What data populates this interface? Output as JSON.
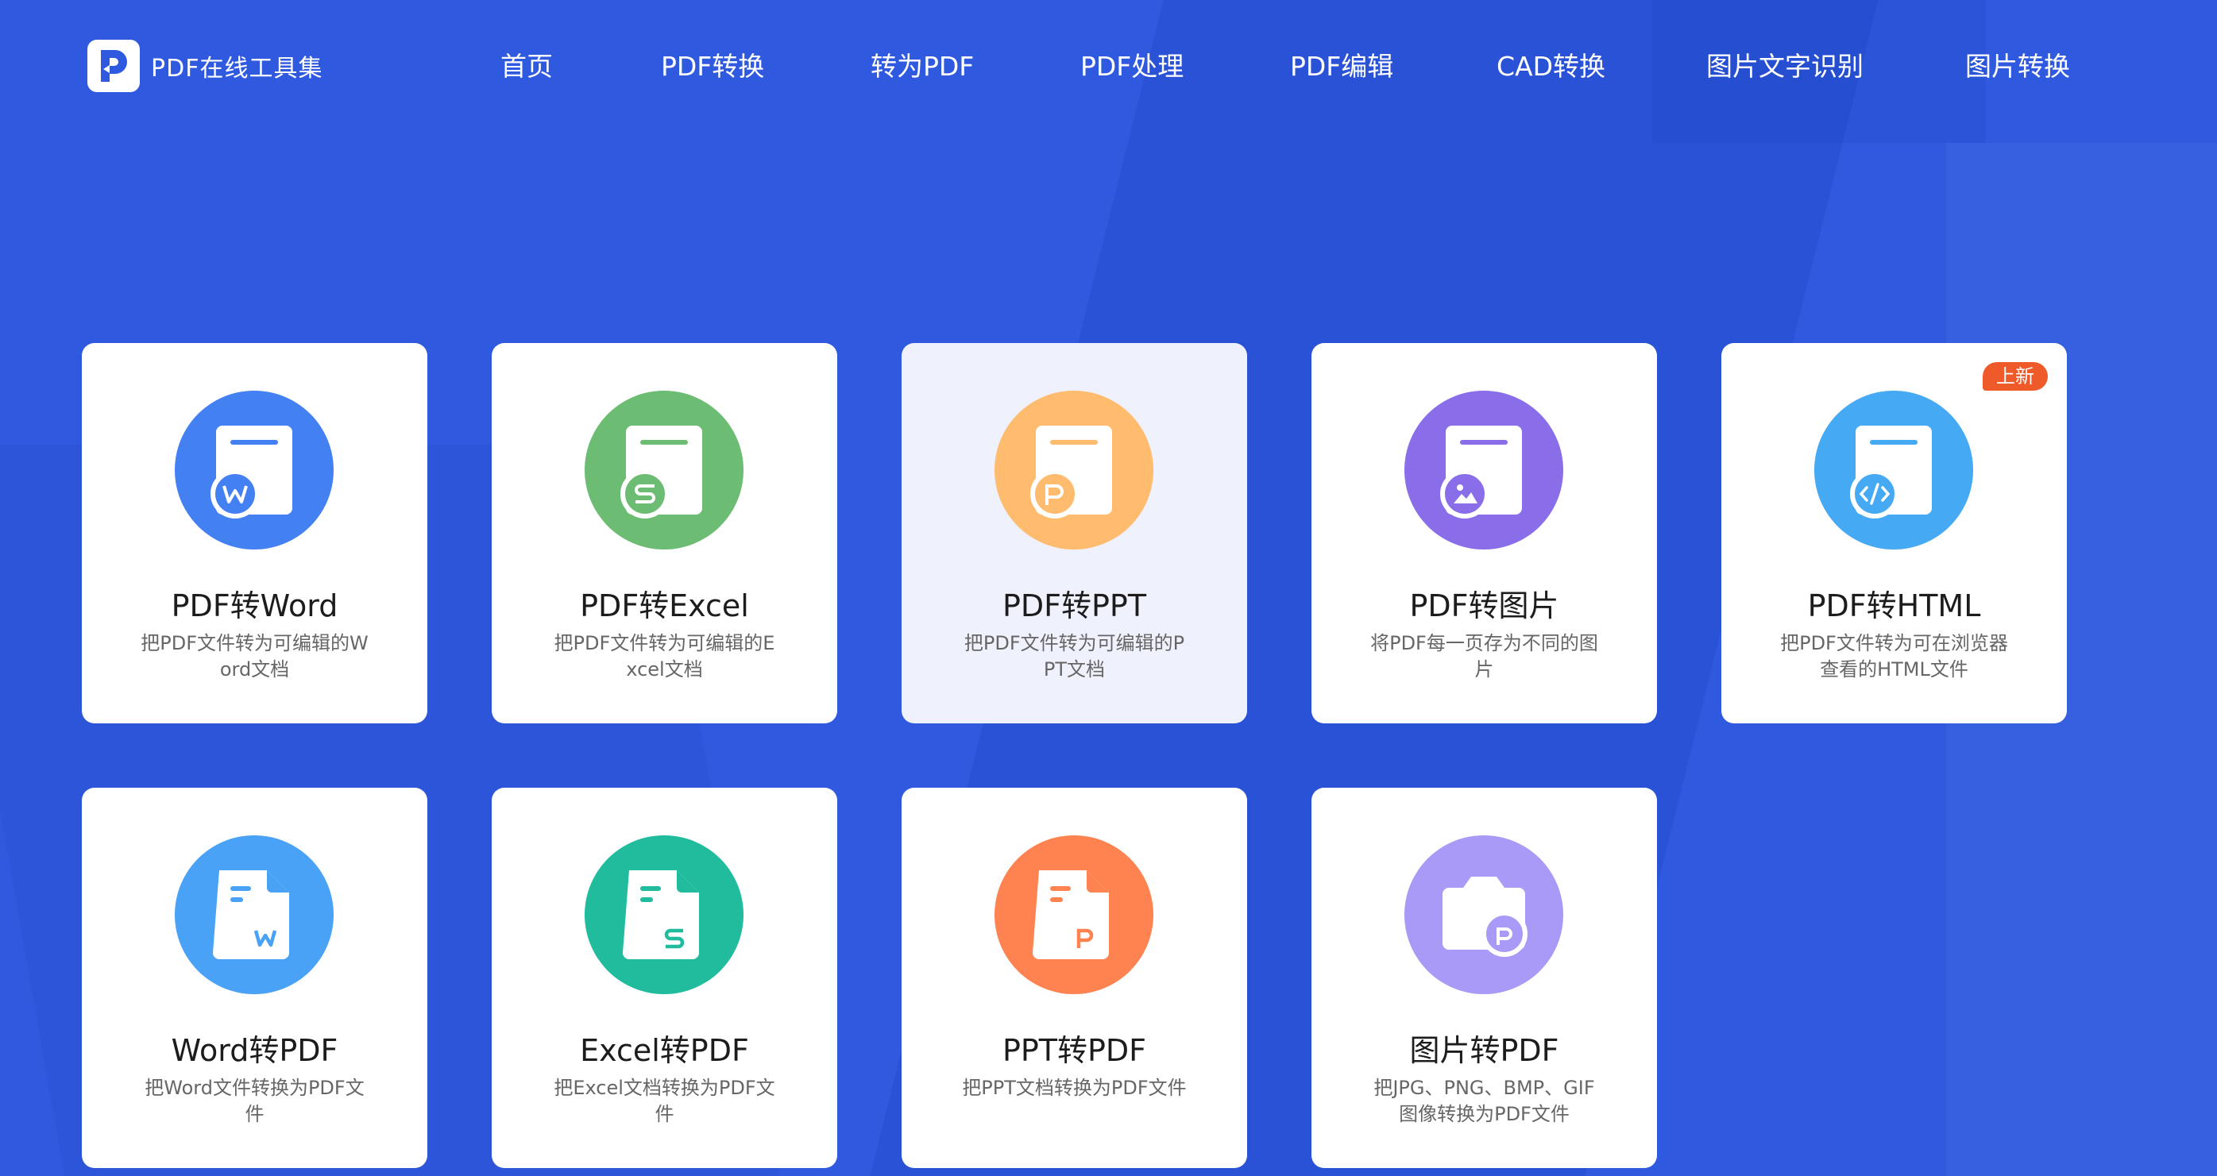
{
  "header": {
    "logo_text": "PDF在线工具集",
    "nav": [
      "首页",
      "PDF转换",
      "转为PDF",
      "PDF处理",
      "PDF编辑",
      "CAD转换",
      "图片文字识别",
      "图片转换"
    ]
  },
  "cards": [
    {
      "title": "PDF转Word",
      "desc": "把PDF文件转为可编辑的Word文档",
      "color": "#4381f3",
      "icon": "pdf-to-word-icon"
    },
    {
      "title": "PDF转Excel",
      "desc": "把PDF文件转为可编辑的Excel文档",
      "color": "#6cbd73",
      "icon": "pdf-to-excel-icon"
    },
    {
      "title": "PDF转PPT",
      "desc": "把PDF文件转为可编辑的PPT文档",
      "color": "#ffbb6e",
      "icon": "pdf-to-ppt-icon"
    },
    {
      "title": "PDF转图片",
      "desc": "将PDF每一页存为不同的图片",
      "color": "#8a6de8",
      "icon": "pdf-to-image-icon"
    },
    {
      "title": "PDF转HTML",
      "desc": "把PDF文件转为可在浏览器查看的HTML文件",
      "color": "#45aaf3",
      "icon": "pdf-to-html-icon",
      "badge": "上新"
    },
    {
      "title": "Word转PDF",
      "desc": "把Word文件转换为PDF文件",
      "color": "#4aa2f7",
      "icon": "word-to-pdf-icon"
    },
    {
      "title": "Excel转PDF",
      "desc": "把Excel文档转换为PDF文件",
      "color": "#21bb9e",
      "icon": "excel-to-pdf-icon"
    },
    {
      "title": "PPT转PDF",
      "desc": "把PPT文档转换为PDF文件",
      "color": "#ff8251",
      "icon": "ppt-to-pdf-icon"
    },
    {
      "title": "图片转PDF",
      "desc": "把JPG、PNG、BMP、GIF图像转换为PDF文件",
      "color": "#a99af7",
      "icon": "image-to-pdf-icon"
    }
  ]
}
